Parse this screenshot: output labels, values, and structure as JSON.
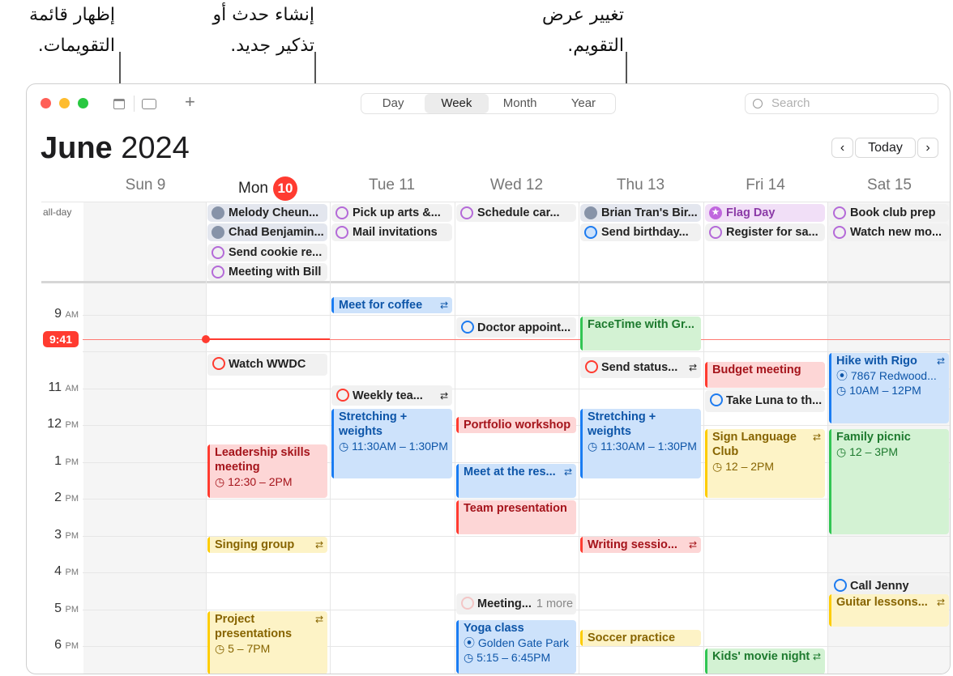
{
  "callouts": {
    "calendar_list": [
      "إظهار قائمة",
      "التقويمات."
    ],
    "new_event": [
      "إنشاء حدث أو",
      "تذكير جديد."
    ],
    "change_view": [
      "تغيير عرض",
      "التقويم."
    ]
  },
  "toolbar": {
    "views": [
      "Day",
      "Week",
      "Month",
      "Year"
    ],
    "selected_view": "Week",
    "search_placeholder": "Search",
    "add_label": "+",
    "icons": [
      "calendar-list-icon",
      "inbox-icon",
      "plus-icon",
      "search-icon"
    ]
  },
  "header": {
    "month": "June",
    "year": "2024",
    "today_label": "Today",
    "prev": "‹",
    "next": "›"
  },
  "days": [
    {
      "label": "Sun 9"
    },
    {
      "label": "Mon",
      "num": "10"
    },
    {
      "label": "Tue 11"
    },
    {
      "label": "Wed 12"
    },
    {
      "label": "Thu 13"
    },
    {
      "label": "Fri 14"
    },
    {
      "label": "Sat 15"
    }
  ],
  "allday_label": "all-day",
  "allday": [
    {
      "day": 1,
      "title": "Melody Cheun...",
      "type": "birthday"
    },
    {
      "day": 1,
      "title": "Chad Benjamin...",
      "type": "birthday"
    },
    {
      "day": 1,
      "title": "Send cookie re...",
      "type": "reminder"
    },
    {
      "day": 1,
      "title": "Meeting with Bill",
      "type": "reminder"
    },
    {
      "day": 2,
      "title": "Pick up arts &...",
      "type": "reminder"
    },
    {
      "day": 2,
      "title": "Mail invitations",
      "type": "reminder"
    },
    {
      "day": 3,
      "title": "Schedule car...",
      "type": "reminder"
    },
    {
      "day": 4,
      "title": "Brian Tran's Bir...",
      "type": "birthday"
    },
    {
      "day": 4,
      "title": "Send birthday...",
      "type": "reminder-blue"
    },
    {
      "day": 5,
      "title": "Flag Day",
      "type": "holiday"
    },
    {
      "day": 5,
      "title": "Register for sa...",
      "type": "reminder"
    },
    {
      "day": 6,
      "title": "Book club prep",
      "type": "reminder"
    },
    {
      "day": 6,
      "title": "Watch new mo...",
      "type": "reminder"
    }
  ],
  "time_labels": [
    {
      "h": "9",
      "ap": "AM"
    },
    {
      "h": "11",
      "ap": "AM"
    },
    {
      "h": "12",
      "ap": "PM"
    },
    {
      "h": "1",
      "ap": "PM"
    },
    {
      "h": "2",
      "ap": "PM"
    },
    {
      "h": "3",
      "ap": "PM"
    },
    {
      "h": "4",
      "ap": "PM"
    },
    {
      "h": "5",
      "ap": "PM"
    },
    {
      "h": "6",
      "ap": "PM"
    }
  ],
  "current_time": "9:41",
  "colors": {
    "red": "#ff3b30",
    "blue": "#1a7cf2",
    "yellow": "#fdcc02",
    "green": "#31c553",
    "purple": "#b46ad8"
  },
  "events": [
    {
      "title": "Watch WWDC",
      "cal": "reminder-red"
    },
    {
      "title": "Leadership skills meeting",
      "cal": "red",
      "time": "12:30 – 2PM"
    },
    {
      "title": "Singing group",
      "cal": "yellow",
      "repeat": true
    },
    {
      "title": "Project presentations",
      "cal": "yellow",
      "time": "5 – 7PM",
      "repeat": true
    },
    {
      "title": "Meet for coffee",
      "cal": "blue",
      "repeat": true
    },
    {
      "title": "Weekly tea...",
      "cal": "reminder-red",
      "repeat": true
    },
    {
      "title": "Stretching + weights",
      "cal": "blue",
      "time": "11:30AM – 1:30PM"
    },
    {
      "title": "Doctor appoint...",
      "cal": "reminder-blue"
    },
    {
      "title": "Portfolio workshop",
      "cal": "red"
    },
    {
      "title": "Meet at the res...",
      "cal": "blue",
      "repeat": true
    },
    {
      "title": "Team presentation",
      "cal": "red"
    },
    {
      "title": "Meeting...",
      "cal": "reminder-faint",
      "more": "1 more"
    },
    {
      "title": "Yoga class",
      "cal": "blue",
      "location": "Golden Gate Park",
      "time": "5:15 – 6:45PM"
    },
    {
      "title": "FaceTime with Gr...",
      "cal": "green"
    },
    {
      "title": "Send status...",
      "cal": "reminder-red",
      "repeat": true
    },
    {
      "title": "Stretching + weights",
      "cal": "blue",
      "time": "11:30AM – 1:30PM"
    },
    {
      "title": "Writing sessio...",
      "cal": "red",
      "repeat": true
    },
    {
      "title": "Soccer practice",
      "cal": "yellow"
    },
    {
      "title": "Budget meeting",
      "cal": "red"
    },
    {
      "title": "Take Luna to th...",
      "cal": "reminder-blue"
    },
    {
      "title": "Sign Language Club",
      "cal": "yellow",
      "time": "12 – 2PM",
      "repeat": true
    },
    {
      "title": "Kids' movie night",
      "cal": "green",
      "repeat": true
    },
    {
      "title": "Hike with Rigo",
      "cal": "blue",
      "location": "7867 Redwood...",
      "time": "10AM – 12PM",
      "repeat": true
    },
    {
      "title": "Family picnic",
      "cal": "green",
      "time": "12 – 3PM"
    },
    {
      "title": "Call Jenny",
      "cal": "reminder-blue"
    },
    {
      "title": "Guitar lessons...",
      "cal": "yellow",
      "repeat": true
    }
  ]
}
